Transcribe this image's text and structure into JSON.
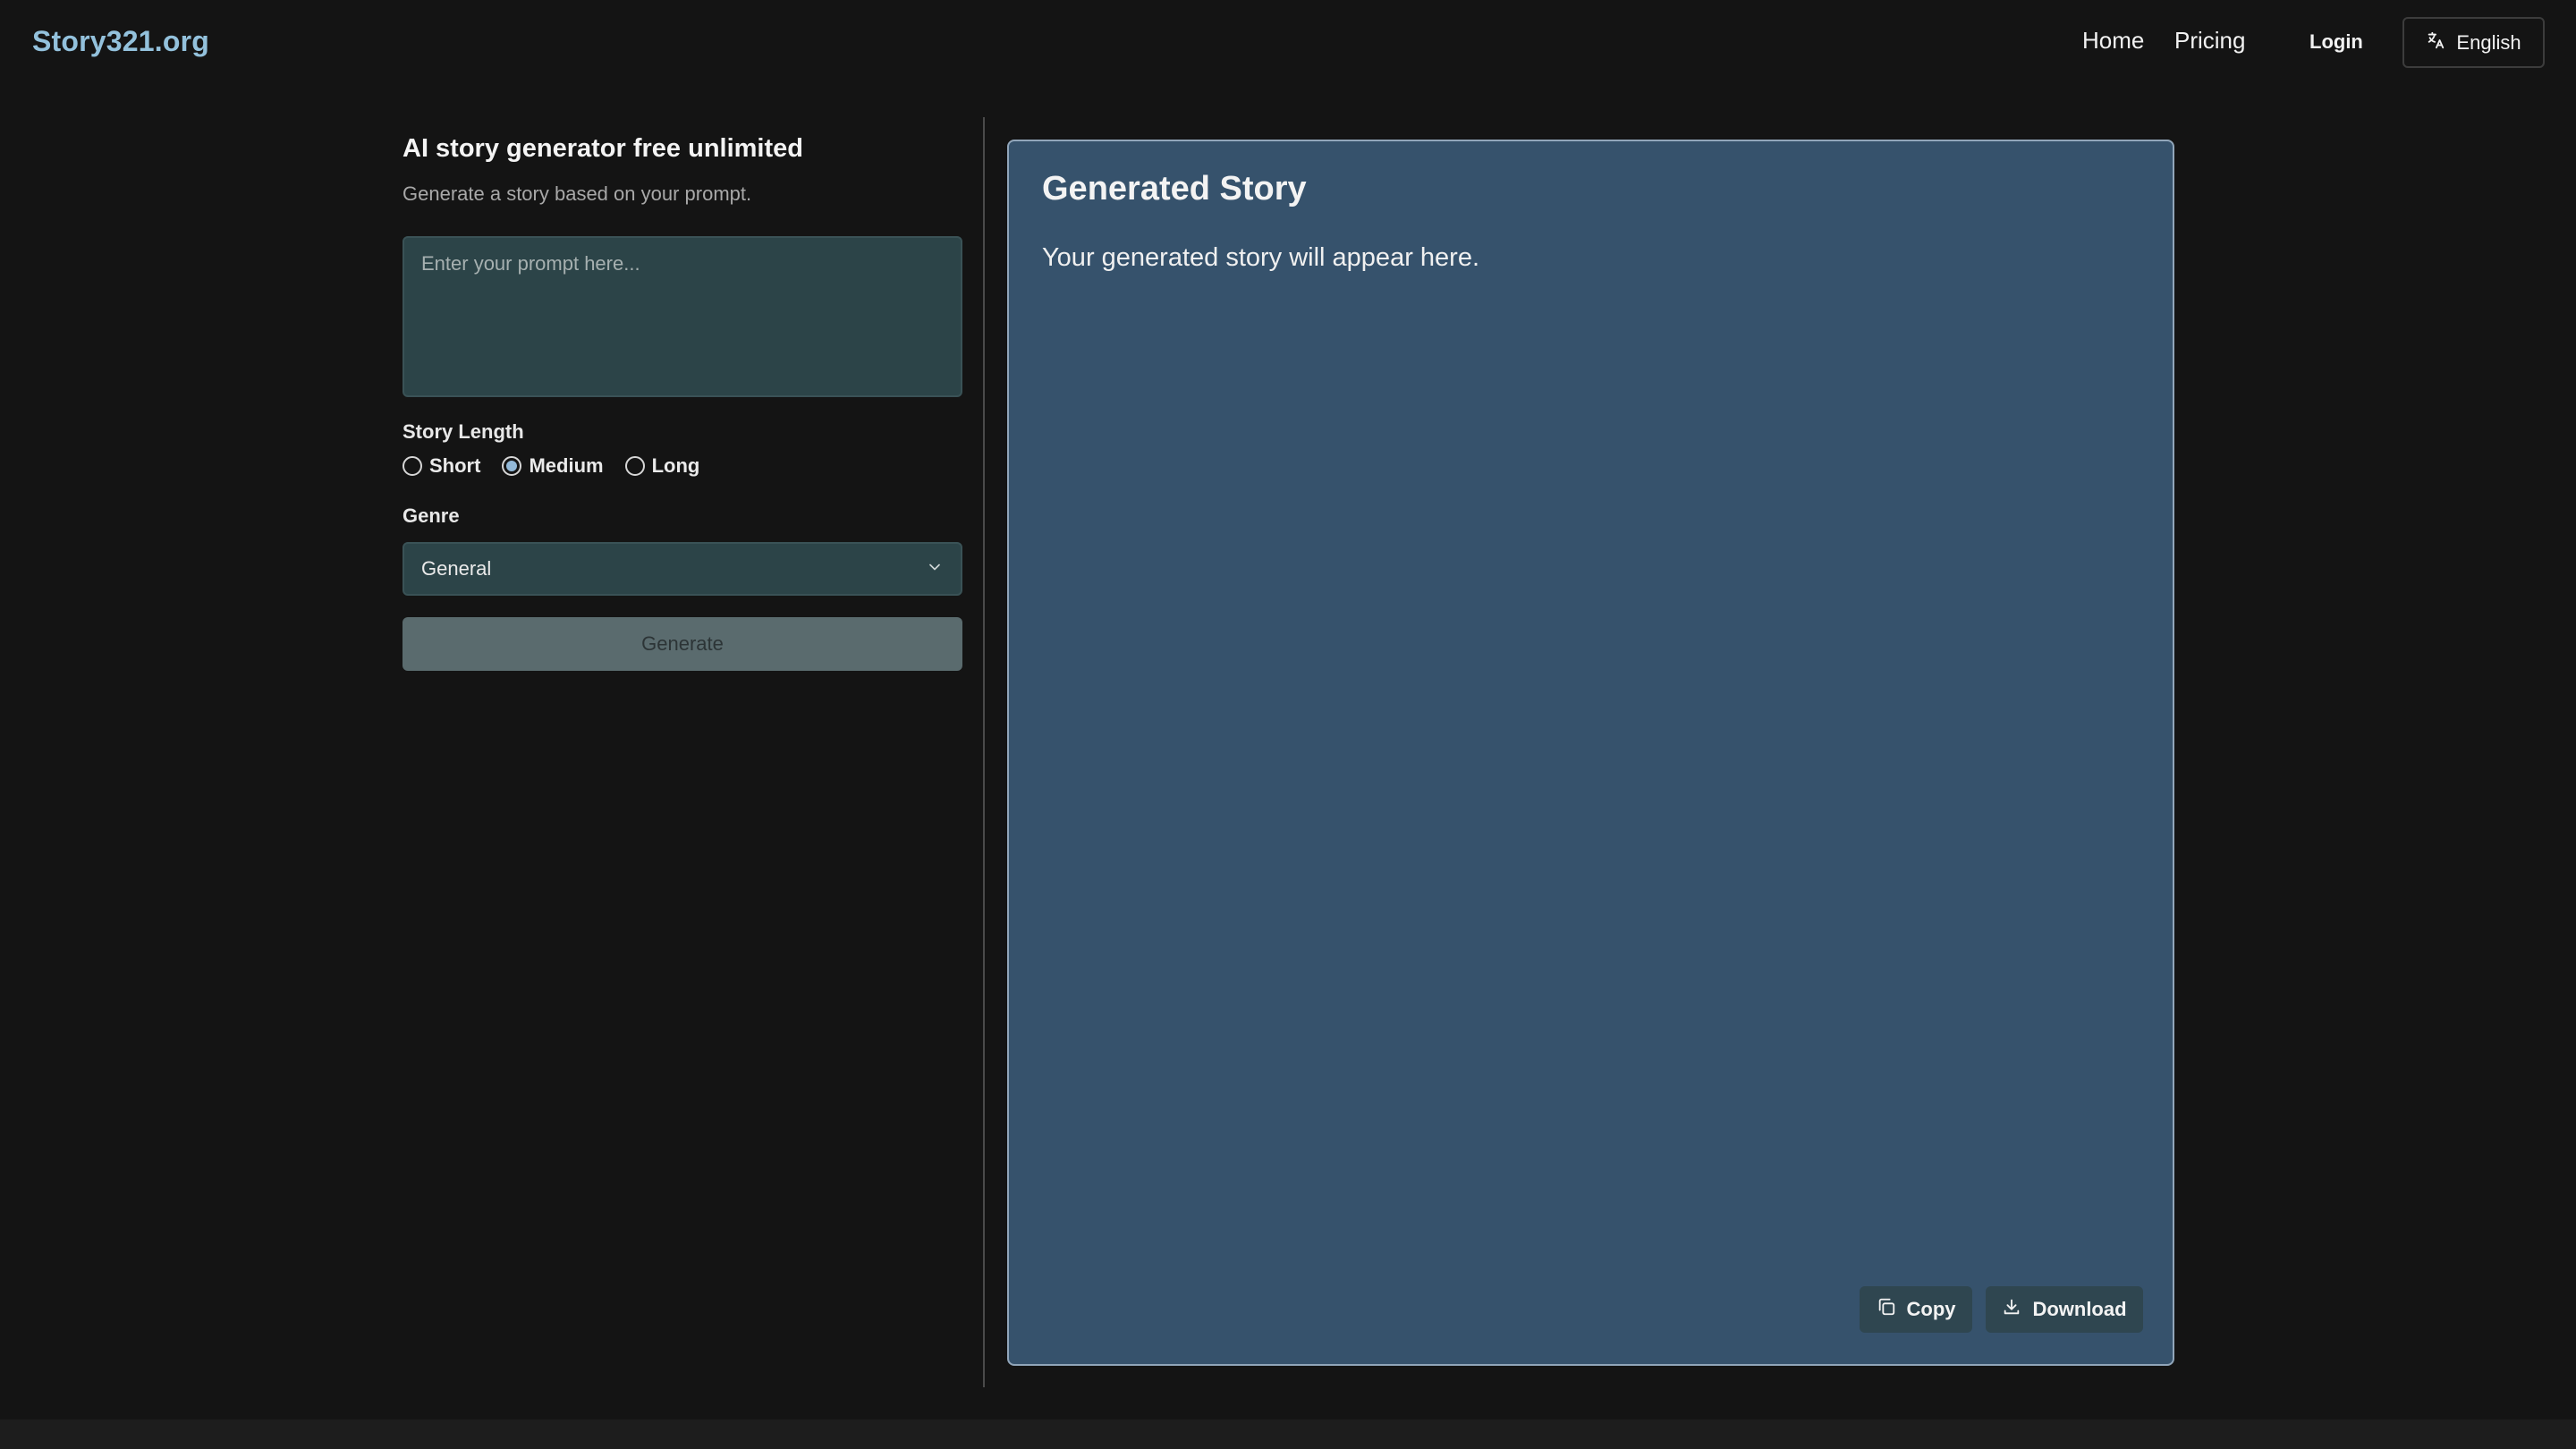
{
  "header": {
    "logo": "Story321.org",
    "nav": [
      {
        "label": "Home"
      },
      {
        "label": "Pricing"
      }
    ],
    "login_label": "Login",
    "language": {
      "label": "English",
      "icon": "translate-icon"
    }
  },
  "form": {
    "title": "AI story generator free unlimited",
    "subtitle": "Generate a story based on your prompt.",
    "prompt": {
      "value": "",
      "placeholder": "Enter your prompt here..."
    },
    "length_label": "Story Length",
    "length_options": [
      {
        "label": "Short",
        "checked": false
      },
      {
        "label": "Medium",
        "checked": true
      },
      {
        "label": "Long",
        "checked": false
      }
    ],
    "genre_label": "Genre",
    "genre_value": "General",
    "generate_label": "Generate"
  },
  "story": {
    "title": "Generated Story",
    "body": "Your generated story will appear here.",
    "copy_label": "Copy",
    "download_label": "Download"
  },
  "colors": {
    "background": "#141414",
    "brand": "#93c1dc",
    "panel": "#36526c",
    "input": "#2c4448"
  }
}
